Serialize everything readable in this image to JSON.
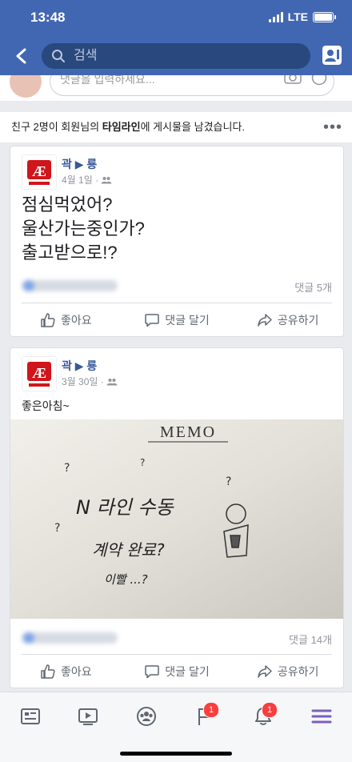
{
  "status_bar": {
    "time": "13:48",
    "network": "LTE"
  },
  "nav": {
    "search_placeholder": "검색"
  },
  "comment_strip": {
    "placeholder": "댓글을 입력하세요..."
  },
  "notice": {
    "prefix": "친구 2명이 회원님의 ",
    "timeline": "타임라인",
    "suffix": "에 게시물을 남겼습니다."
  },
  "posts": [
    {
      "author": "곽 ▶ 룡",
      "date": "4월 1일 ·",
      "text_lines": [
        "점심먹었어?",
        "울산가는중인가?",
        "출고받으로!?"
      ],
      "comment_count": "댓글 5개"
    },
    {
      "author": "곽 ▶ 룡",
      "date": "3월 30일 ·",
      "text": "좋은아침~",
      "photo": {
        "heading": "MEMO",
        "line1": "N 라인 수동",
        "line2": "계약 완료?",
        "line3": "이빨 ...?"
      },
      "comment_count": "댓글 14개"
    }
  ],
  "actions": {
    "like": "좋아요",
    "comment": "댓글 달기",
    "share": "공유하기"
  },
  "tabs": {
    "groups_badge": "1",
    "notifications_badge": "1"
  },
  "colors": {
    "brand": "#4267b2",
    "accent_menu": "#7b5fbf",
    "badge": "#fa3e3e"
  }
}
